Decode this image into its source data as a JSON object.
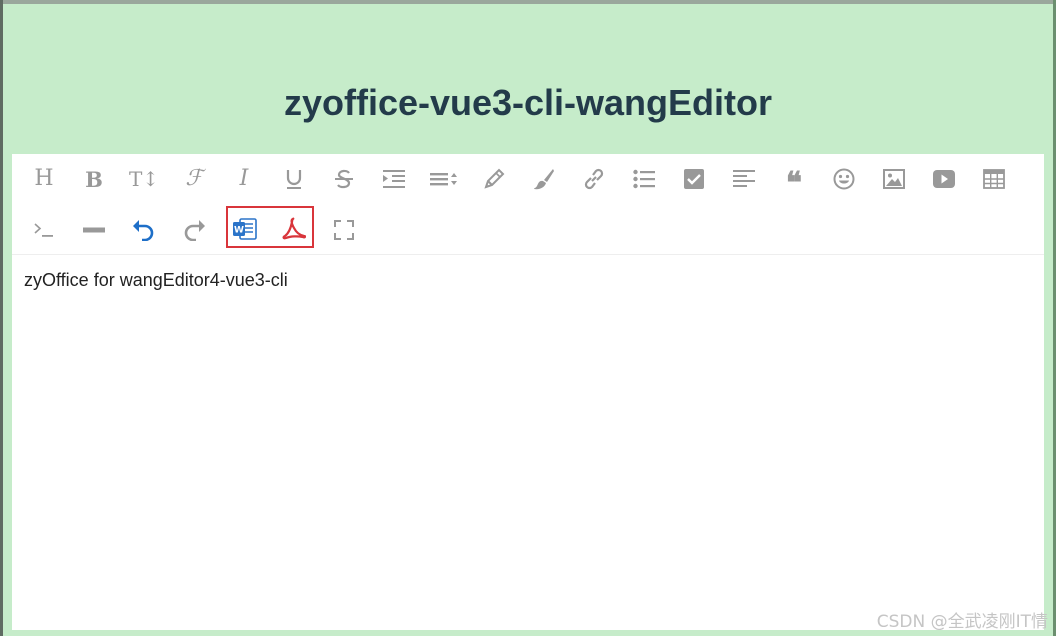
{
  "page": {
    "title": "zyoffice-vue3-cli-wangEditor"
  },
  "toolbar": {
    "row1": [
      {
        "name": "heading-icon",
        "glyph": "H"
      },
      {
        "name": "bold-icon",
        "glyph": "B"
      },
      {
        "name": "font-size-icon",
        "glyph": "T↕"
      },
      {
        "name": "font-family-icon",
        "glyph": "F"
      },
      {
        "name": "italic-icon",
        "glyph": "I"
      },
      {
        "name": "underline-icon",
        "glyph": "U"
      },
      {
        "name": "strikethrough-icon",
        "glyph": "S"
      },
      {
        "name": "indent-icon",
        "glyph": ""
      },
      {
        "name": "line-height-icon",
        "glyph": ""
      },
      {
        "name": "font-color-icon",
        "glyph": ""
      },
      {
        "name": "background-color-icon",
        "glyph": ""
      },
      {
        "name": "link-icon",
        "glyph": ""
      },
      {
        "name": "list-icon",
        "glyph": ""
      },
      {
        "name": "todo-icon",
        "glyph": ""
      },
      {
        "name": "justify-icon",
        "glyph": ""
      },
      {
        "name": "quote-icon",
        "glyph": "❝"
      },
      {
        "name": "emoticon-icon",
        "glyph": ""
      },
      {
        "name": "image-icon",
        "glyph": ""
      },
      {
        "name": "video-icon",
        "glyph": ""
      },
      {
        "name": "table-icon",
        "glyph": ""
      }
    ],
    "row2": [
      {
        "name": "code-icon",
        "glyph": ">_"
      },
      {
        "name": "divider-icon",
        "glyph": ""
      },
      {
        "name": "undo-icon",
        "glyph": ""
      },
      {
        "name": "redo-icon",
        "glyph": ""
      },
      {
        "name": "word-import-icon",
        "glyph": "W"
      },
      {
        "name": "pdf-import-icon",
        "glyph": ""
      },
      {
        "name": "fullscreen-icon",
        "glyph": ""
      }
    ],
    "colors": {
      "icon": "#999999",
      "undo": "#1e6fc8",
      "word": "#2b74c9",
      "pdf": "#d9353b",
      "highlight": "#d9353b"
    }
  },
  "editor": {
    "content": "zyOffice for wangEditor4-vue3-cli"
  },
  "watermark": "CSDN @全武凌刚IT情",
  "colors": {
    "background": "#c6ecca",
    "title": "#233b4a"
  }
}
